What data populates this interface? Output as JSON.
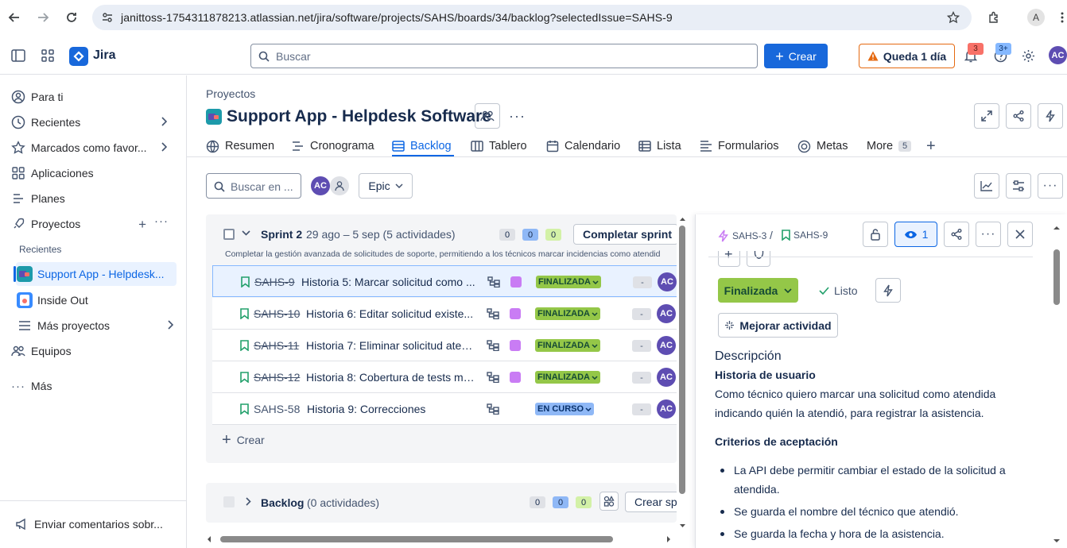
{
  "browser": {
    "url": "janittoss-1754311878213.atlassian.net/jira/software/projects/SAHS/boards/34/backlog?selectedIssue=SAHS-9",
    "profile_initial": "A"
  },
  "topbar": {
    "app_name": "Jira",
    "search_placeholder": "Buscar",
    "create_label": "Crear",
    "trial_label": "Queda 1 día",
    "notifications_count": "3",
    "help_count": "3+",
    "user_initials": "AC"
  },
  "sidebar": {
    "items": [
      {
        "label": "Para ti"
      },
      {
        "label": "Recientes"
      },
      {
        "label": "Marcados como favor..."
      },
      {
        "label": "Aplicaciones"
      },
      {
        "label": "Planes"
      },
      {
        "label": "Proyectos"
      }
    ],
    "recent_label": "Recientes",
    "recent_projects": [
      {
        "label": "Support App - Helpdesk..."
      },
      {
        "label": "Inside Out"
      },
      {
        "label": "Más proyectos"
      }
    ],
    "teams_label": "Equipos",
    "more_label": "Más",
    "feedback_label": "Enviar comentarios sobr..."
  },
  "header": {
    "breadcrumb": "Proyectos",
    "project_title": "Support App - Helpdesk Software",
    "tabs": [
      {
        "label": "Resumen"
      },
      {
        "label": "Cronograma"
      },
      {
        "label": "Backlog"
      },
      {
        "label": "Tablero"
      },
      {
        "label": "Calendario"
      },
      {
        "label": "Lista"
      },
      {
        "label": "Formularios"
      },
      {
        "label": "Metas"
      },
      {
        "label": "More"
      }
    ],
    "more_count": "5"
  },
  "toolbar": {
    "search_placeholder": "Buscar en ...",
    "avatar_initials": "AC",
    "epic_label": "Epic"
  },
  "sprint": {
    "name": "Sprint 2",
    "dates": "29 ago – 5 sep (5 actividades)",
    "counts": [
      "0",
      "0",
      "0"
    ],
    "complete_label": "Completar sprint",
    "goal": "Completar la gestión avanzada de solicitudes de soporte, permitiendo a los técnicos marcar incidencias como atendid",
    "issues": [
      {
        "key": "SAHS-9",
        "summary": "Historia 5: Marcar solicitud como ...",
        "status": "FINALIZADA",
        "estimate": "-",
        "assignee": "AC"
      },
      {
        "key": "SAHS-10",
        "summary": "Historia 6: Editar solicitud existe...",
        "status": "FINALIZADA",
        "estimate": "-",
        "assignee": "AC"
      },
      {
        "key": "SAHS-11",
        "summary": "Historia 7: Eliminar solicitud aten...",
        "status": "FINALIZADA",
        "estimate": "-",
        "assignee": "AC"
      },
      {
        "key": "SAHS-12",
        "summary": "Historia 8: Cobertura de tests mí...",
        "status": "FINALIZADA",
        "estimate": "-",
        "assignee": "AC"
      },
      {
        "key": "SAHS-58",
        "summary": "Historia 9: Correcciones",
        "status": "EN CURSO",
        "estimate": "-",
        "assignee": "AC"
      }
    ],
    "create_label": "Crear"
  },
  "backlog": {
    "name": "Backlog",
    "count_text": "(0 actividades)",
    "counts": [
      "0",
      "0",
      "0"
    ],
    "create_label": "Crear sp"
  },
  "detail": {
    "parent_key": "SAHS-3",
    "separator": "/",
    "issue_key": "SAHS-9",
    "watchers": "1",
    "status_label": "Finalizada",
    "ready_label": "Listo",
    "improve_label": "Mejorar actividad",
    "description_title": "Descripción",
    "story_title": "Historia de usuario",
    "story_body": "Como técnico quiero marcar una solicitud como atendida indicando quién la atendió, para registrar la asistencia.",
    "criteria_title": "Criterios de aceptación",
    "criteria": [
      "La API debe permitir cambiar el estado de la solicitud a atendida.",
      "Se guarda el nombre del técnico que atendió.",
      "Se guarda la fecha y hora de la asistencia."
    ]
  },
  "colors": {
    "brand": "#1868db",
    "done_status": "#94c748",
    "in_progress_status": "#8fb8f6",
    "epic": "#c97cf4",
    "avatar": "#5e4db2"
  }
}
